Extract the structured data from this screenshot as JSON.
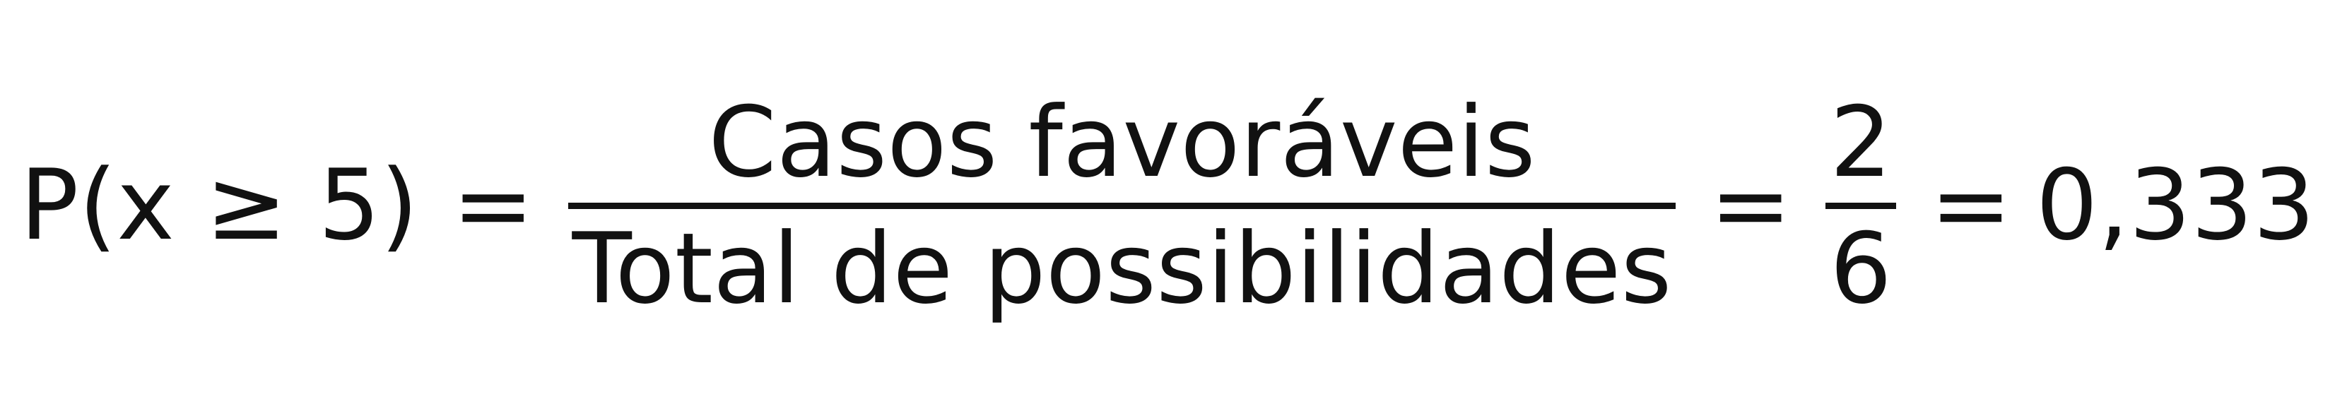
{
  "formula": {
    "lhs": "P(x ≥ 5)",
    "eq1": "=",
    "fraction1": {
      "numerator": "Casos favoráveis",
      "denominator": "Total de possibilidades"
    },
    "eq2": "=",
    "fraction2": {
      "numerator": "2",
      "denominator": "6"
    },
    "eq3": "=",
    "result": "0,333"
  }
}
